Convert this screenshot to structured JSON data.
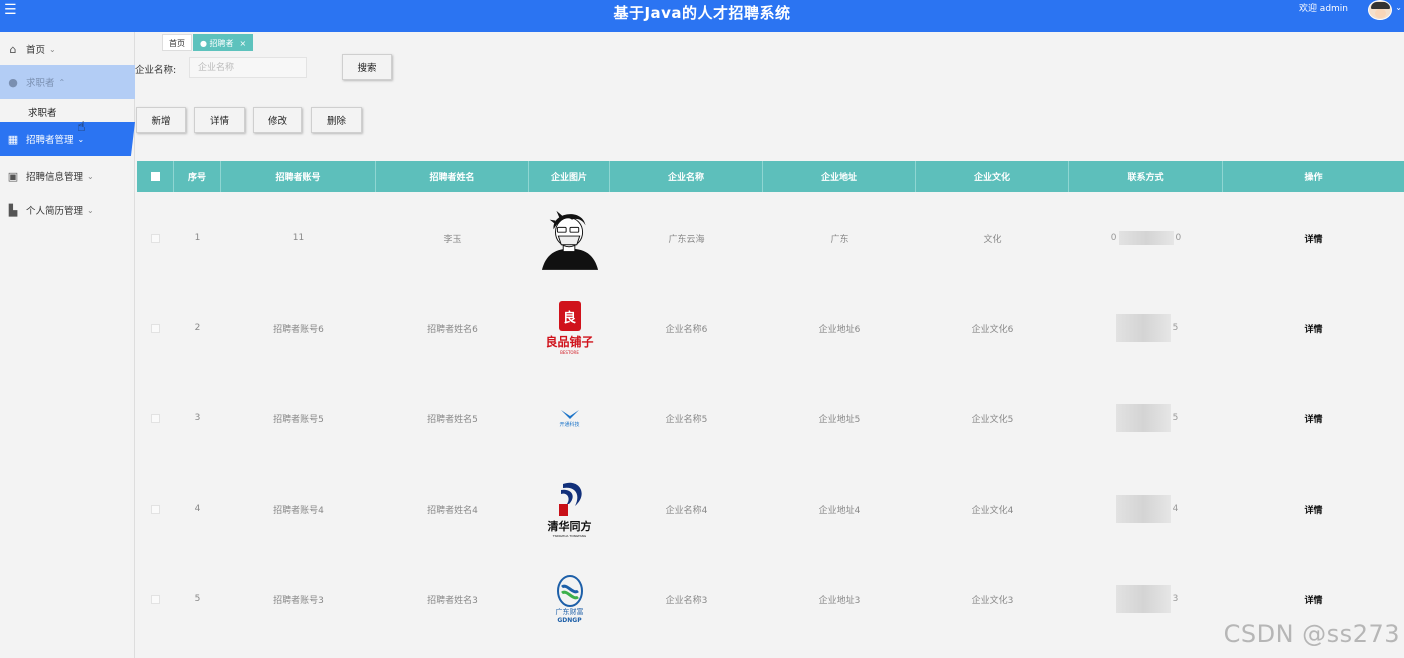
{
  "header": {
    "menu_icon": "menu-icon",
    "title": "基于Java的人才招聘系统",
    "welcome": "欢迎 admin"
  },
  "sidebar": {
    "items": [
      {
        "label": "首页",
        "icon": "home-icon"
      },
      {
        "label": "求职者",
        "icon": "user-icon"
      },
      {
        "label": "招聘者管理",
        "icon": "grid-icon"
      },
      {
        "label": "招聘信息管理",
        "icon": "document-icon"
      },
      {
        "label": "个人简历管理",
        "icon": "chart-icon"
      }
    ],
    "sub_item": "求职者"
  },
  "tabs": [
    {
      "label": "首页"
    },
    {
      "label": "招聘者",
      "close": "×"
    }
  ],
  "search": {
    "label": "企业名称:",
    "placeholder": "企业名称",
    "button": "搜索"
  },
  "actions": {
    "add": "新增",
    "detail": "详情",
    "edit": "修改",
    "delete": "删除"
  },
  "table": {
    "columns": [
      "序号",
      "招聘者账号",
      "招聘者姓名",
      "企业图片",
      "企业名称",
      "企业地址",
      "企业文化",
      "联系方式",
      "操作"
    ],
    "rows": [
      {
        "index": "1",
        "account": "11",
        "name": "李玉",
        "logo": "avatar-cartoon",
        "company": "广东云海",
        "address": "广东",
        "culture": "文化",
        "phone_start": "0",
        "phone_end": "0",
        "action": "详情"
      },
      {
        "index": "2",
        "account": "招聘者账号6",
        "name": "招聘者姓名6",
        "logo": "liangpin-logo",
        "company": "企业名称6",
        "address": "企业地址6",
        "culture": "企业文化6",
        "phone_start": "",
        "phone_end": "5",
        "action": "详情"
      },
      {
        "index": "3",
        "account": "招聘者账号5",
        "name": "招聘者姓名5",
        "logo": "tech-logo",
        "company": "企业名称5",
        "address": "企业地址5",
        "culture": "企业文化5",
        "phone_start": "",
        "phone_end": "5",
        "action": "详情"
      },
      {
        "index": "4",
        "account": "招聘者账号4",
        "name": "招聘者姓名4",
        "logo": "tsinghua-tongfang-logo",
        "company": "企业名称4",
        "address": "企业地址4",
        "culture": "企业文化4",
        "phone_start": "",
        "phone_end": "4",
        "action": "详情"
      },
      {
        "index": "5",
        "account": "招聘者账号3",
        "name": "招聘者姓名3",
        "logo": "guangdong-logo",
        "company": "企业名称3",
        "address": "企业地址3",
        "culture": "企业文化3",
        "phone_start": "",
        "phone_end": "3",
        "action": "详情"
      }
    ]
  },
  "logo_text": {
    "liangpin": "良品铺子",
    "liangpin_sub": "BESTORE",
    "tech": "开通科技",
    "tongfang": "清华同方",
    "tongfang_sub": "TSINGHUA TONGFANG",
    "guangdong": "广东财富",
    "guangdong_sub": "GDNGP"
  },
  "watermark": "CSDN @ss273",
  "colors": {
    "primary": "#2b74f2",
    "table_header": "#5dbfbb"
  }
}
